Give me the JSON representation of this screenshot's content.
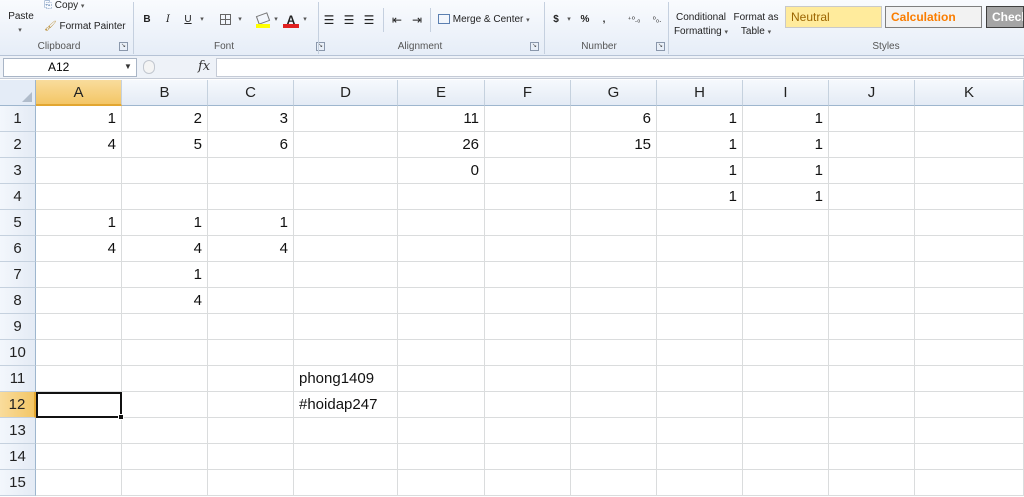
{
  "ribbon": {
    "clipboard": {
      "label": "Clipboard",
      "paste": "Paste",
      "copy": "Copy",
      "format_painter": "Format Painter"
    },
    "font": {
      "label": "Font",
      "bold": "B",
      "italic": "I",
      "underline": "U",
      "font_color": "A"
    },
    "alignment": {
      "label": "Alignment",
      "merge_center": "Merge & Center"
    },
    "number": {
      "label": "Number",
      "currency": "$",
      "percent": "%",
      "comma": ","
    },
    "styles": {
      "label": "Styles",
      "conditional_formatting_1": "Conditional",
      "conditional_formatting_2": "Formatting",
      "format_table_1": "Format as",
      "format_table_2": "Table",
      "neutral": "Neutral",
      "calculation": "Calculation",
      "check": "Check"
    }
  },
  "formula_bar": {
    "name_box": "A12",
    "fx": "fx",
    "content": ""
  },
  "grid": {
    "columns": [
      "A",
      "B",
      "C",
      "D",
      "E",
      "F",
      "G",
      "H",
      "I",
      "J",
      "K"
    ],
    "rows": [
      "1",
      "2",
      "3",
      "4",
      "5",
      "6",
      "7",
      "8",
      "9",
      "10",
      "11",
      "12",
      "13",
      "14",
      "15"
    ],
    "selected_column": "A",
    "selected_row": "12",
    "cells": {
      "A1": "1",
      "B1": "2",
      "C1": "3",
      "E1": "11",
      "G1": "6",
      "H1": "1",
      "I1": "1",
      "A2": "4",
      "B2": "5",
      "C2": "6",
      "E2": "26",
      "G2": "15",
      "H2": "1",
      "I2": "1",
      "E3": "0",
      "H3": "1",
      "I3": "1",
      "H4": "1",
      "I4": "1",
      "A5": "1",
      "B5": "1",
      "C5": "1",
      "A6": "4",
      "B6": "4",
      "C6": "4",
      "B7": "1",
      "B8": "4",
      "D11": "phong1409",
      "D12": "#hoidap247"
    },
    "text_cells": [
      "D11",
      "D12"
    ]
  },
  "colors": {
    "selection_header": "#f3c666",
    "neutral_style_bg": "#ffeb9c",
    "calculation_text": "#fa7d00",
    "check_style_bg": "#a5a5a5"
  }
}
